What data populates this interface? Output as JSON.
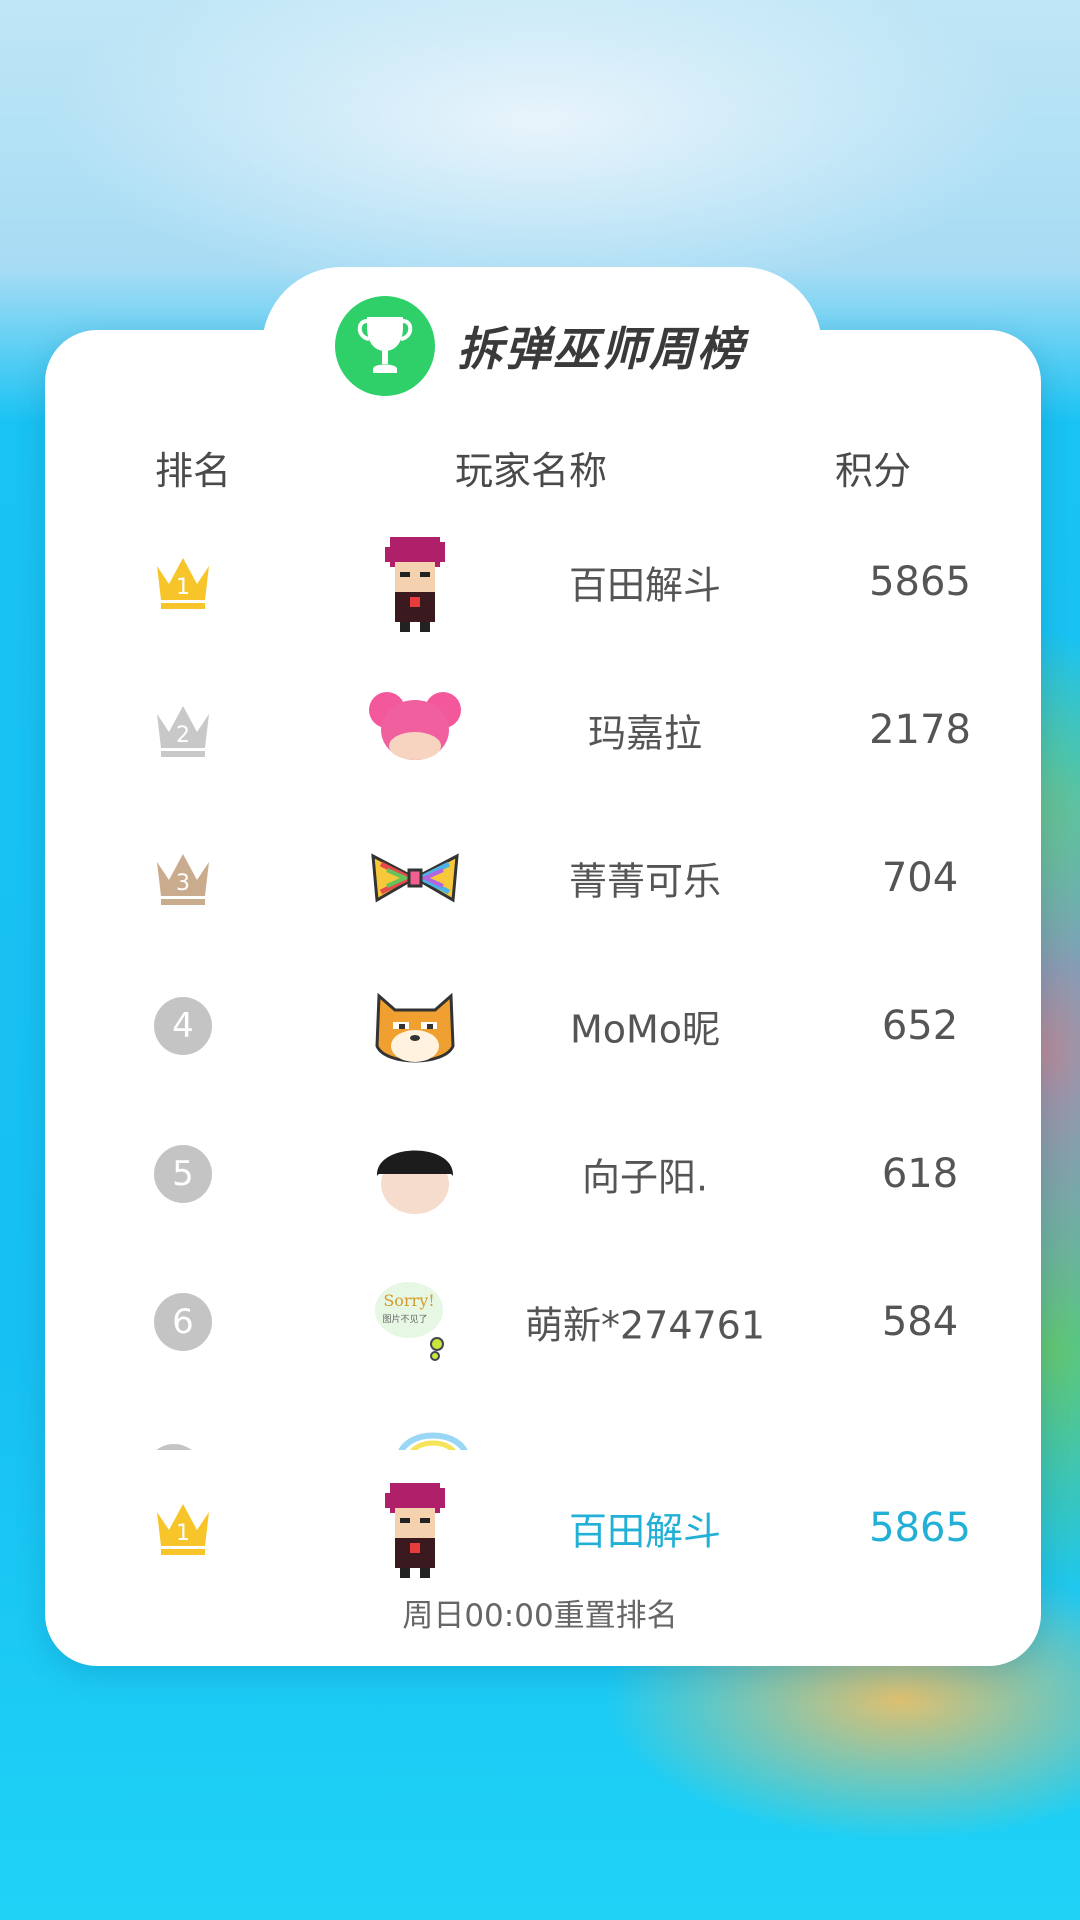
{
  "board": {
    "title": "拆弹巫师周榜",
    "trophy_icon": "trophy-icon",
    "accent_color": "#2fd06a",
    "columns": {
      "rank": "排名",
      "player": "玩家名称",
      "score": "积分"
    }
  },
  "rows": [
    {
      "rank": "1",
      "name": "百田解斗",
      "score": "5865",
      "badge": "gold-crown",
      "avatar": "red-hair-avatar"
    },
    {
      "rank": "2",
      "name": "玛嘉拉",
      "score": "2178",
      "badge": "silver-crown",
      "avatar": "pink-buns-avatar"
    },
    {
      "rank": "3",
      "name": "菁菁可乐",
      "score": "704",
      "badge": "bronze-crown",
      "avatar": "rainbow-bow-avatar"
    },
    {
      "rank": "4",
      "name": "MoMo昵",
      "score": "652",
      "badge": "grey-circle",
      "avatar": "shiba-avatar"
    },
    {
      "rank": "5",
      "name": "向子阳.",
      "score": "618",
      "badge": "grey-circle",
      "avatar": "black-hair-avatar"
    },
    {
      "rank": "6",
      "name": "萌新*274761",
      "score": "584",
      "badge": "grey-circle",
      "avatar": "sorry-bubble-avatar"
    }
  ],
  "avatar_texts": {
    "sorry": "Sorry!",
    "sorry_sub": "图片不见了"
  },
  "my_rank": {
    "rank": "1",
    "name": "百田解斗",
    "score": "5865",
    "color": "#23b0d6"
  },
  "footer": {
    "reset_note": "周日00:00重置排名"
  }
}
